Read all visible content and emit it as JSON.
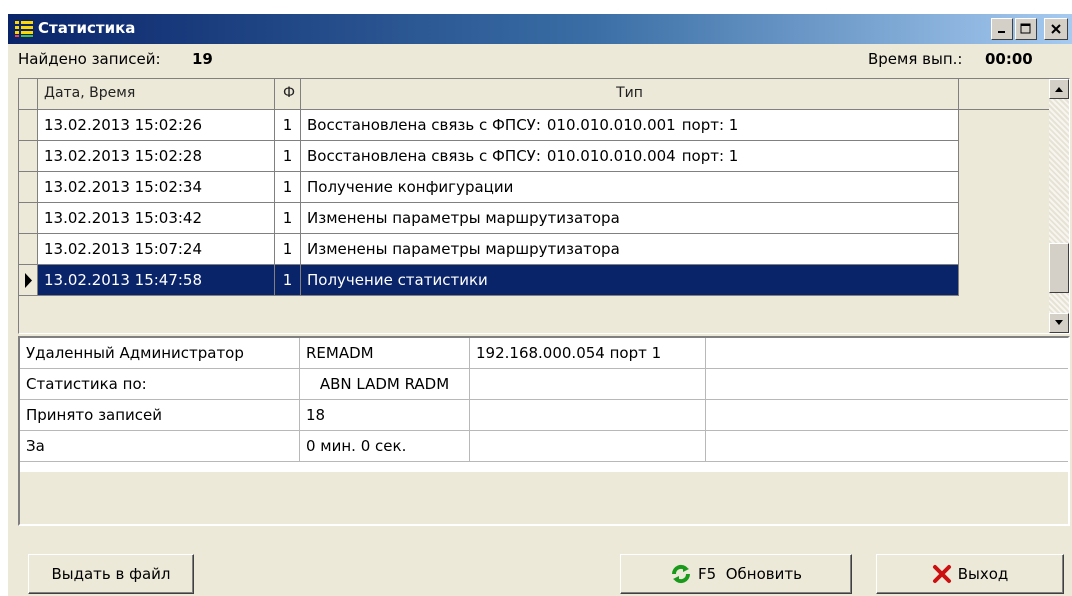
{
  "window": {
    "title": "Статистика"
  },
  "info": {
    "found_label": "Найдено записей:",
    "found_count": "19",
    "time_label": "Время вып.:",
    "time_value": "00:00"
  },
  "grid": {
    "columns": [
      "Дата, Время",
      "Ф",
      "Тип"
    ],
    "rows": [
      {
        "datetime": "13.02.2013 15:02:26",
        "f": "1",
        "type": "Восстановлена связь с ФПСУ:",
        "ip": "010.010.010.001",
        "port": "порт: 1"
      },
      {
        "datetime": "13.02.2013 15:02:28",
        "f": "1",
        "type": "Восстановлена связь с ФПСУ:",
        "ip": "010.010.010.004",
        "port": "порт: 1"
      },
      {
        "datetime": "13.02.2013 15:02:34",
        "f": "1",
        "type": "Получение конфигурации",
        "ip": "",
        "port": ""
      },
      {
        "datetime": "13.02.2013 15:03:42",
        "f": "1",
        "type": "Изменены параметры маршрутизатора",
        "ip": "",
        "port": ""
      },
      {
        "datetime": "13.02.2013 15:07:24",
        "f": "1",
        "type": "Изменены параметры маршрутизатора",
        "ip": "",
        "port": ""
      },
      {
        "datetime": "13.02.2013 15:47:58",
        "f": "1",
        "type": "Получение статистики",
        "ip": "",
        "port": ""
      }
    ],
    "selected_index": 5
  },
  "details": {
    "rows": [
      [
        "Удаленный Администратор",
        "REMADM",
        "192.168.000.054 порт 1"
      ],
      [
        "Статистика по:",
        "ABN LADM RADM",
        ""
      ],
      [
        "Принято записей",
        "18",
        ""
      ],
      [
        "За",
        "0 мин. 0 сек.",
        ""
      ]
    ]
  },
  "buttons": {
    "export": "Выдать в файл",
    "refresh": "F5  Обновить",
    "exit": "Выход"
  },
  "colors": {
    "selection": "#0a246a",
    "title_gradient_start": "#0a246a",
    "window_bg": "#ece9d8",
    "refresh_icon": "#1a9a1a",
    "exit_icon": "#cc1010"
  },
  "icons": [
    "grid-app-icon",
    "minimize-icon",
    "maximize-icon",
    "close-icon",
    "scroll-up-icon",
    "scroll-down-icon",
    "row-pointer-icon",
    "refresh-icon",
    "cross-icon"
  ]
}
